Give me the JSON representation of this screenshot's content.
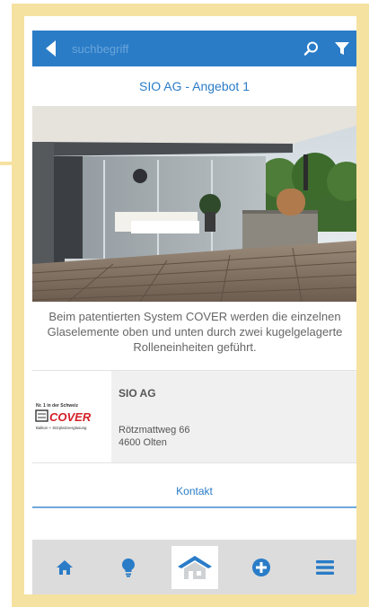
{
  "search": {
    "placeholder": "suchbegriff"
  },
  "header": {
    "title": "SIO AG - Angebot 1"
  },
  "offer": {
    "description": "Beim patentierten System COVER werden die einzelnen Glaselemente oben und unten durch zwei kugelgelagerte Rolleneinheiten geführt."
  },
  "company": {
    "logo_tagline": "Nr. 1 in der Schweiz",
    "logo_brand": "COVER",
    "logo_subline": "Balkon + Sitzplatzverglasung",
    "name": "SIO AG",
    "street": "Rötzmattweg 66",
    "city": "4600 Olten"
  },
  "contact": {
    "label": "Kontakt"
  },
  "tabbar": {
    "items": [
      {
        "icon": "home-icon"
      },
      {
        "icon": "lightbulb-icon"
      },
      {
        "icon": "house-roof-icon",
        "active": true
      },
      {
        "icon": "plus-circle-icon"
      },
      {
        "icon": "menu-icon"
      }
    ]
  },
  "colors": {
    "accent": "#2a7cc7",
    "tabbar_bg": "#dcdcdc",
    "frame": "#f6e2a0",
    "logo_red": "#d42027"
  }
}
